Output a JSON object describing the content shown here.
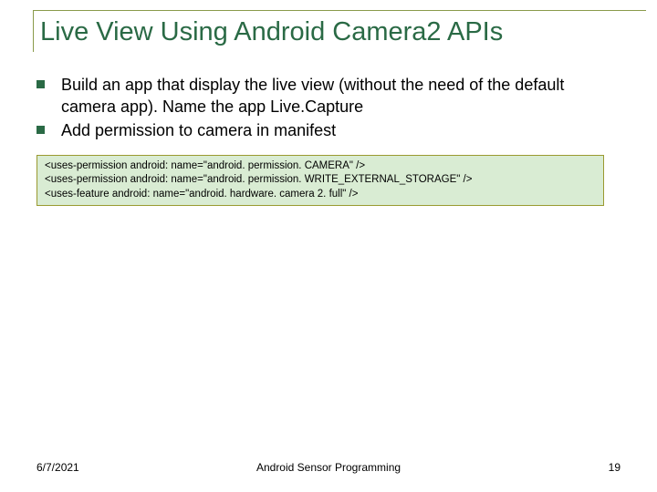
{
  "slide": {
    "title": "Live View Using Android Camera2 APIs",
    "bullets": [
      "Build an app that display the live view (without the need of the default camera app). Name the app Live.Capture",
      "Add permission to camera in manifest"
    ],
    "code": "<uses-permission android: name=\"android. permission. CAMERA\" />\n<uses-permission android: name=\"android. permission. WRITE_EXTERNAL_STORAGE\" />\n<uses-feature android: name=\"android. hardware. camera 2. full\" />"
  },
  "footer": {
    "date": "6/7/2021",
    "course": "Android Sensor Programming",
    "page": "19"
  }
}
